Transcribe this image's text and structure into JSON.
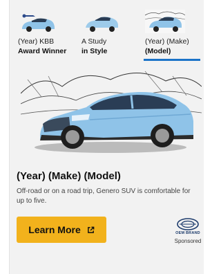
{
  "tabs": [
    {
      "line1": "(Year) KBB",
      "line2": "Award Winner",
      "active": false
    },
    {
      "line1": "A Study",
      "line2": "in Style",
      "active": false
    },
    {
      "line1": "(Year) (Make)",
      "line2": "(Model)",
      "active": true
    }
  ],
  "card": {
    "title": "(Year) (Make) (Model)",
    "description": "Off-road or on a road trip, Genero SUV is comfortable for up to five.",
    "cta_label": "Learn More",
    "oem_label": "OEM BRAND",
    "sponsored_label": "Sponsored"
  },
  "colors": {
    "accent": "#1a73c8",
    "cta": "#f2b21c",
    "car": "#8fc3e8"
  },
  "icons": [
    "kbb-award-icon",
    "external-link-icon",
    "oem-brand-logo"
  ]
}
